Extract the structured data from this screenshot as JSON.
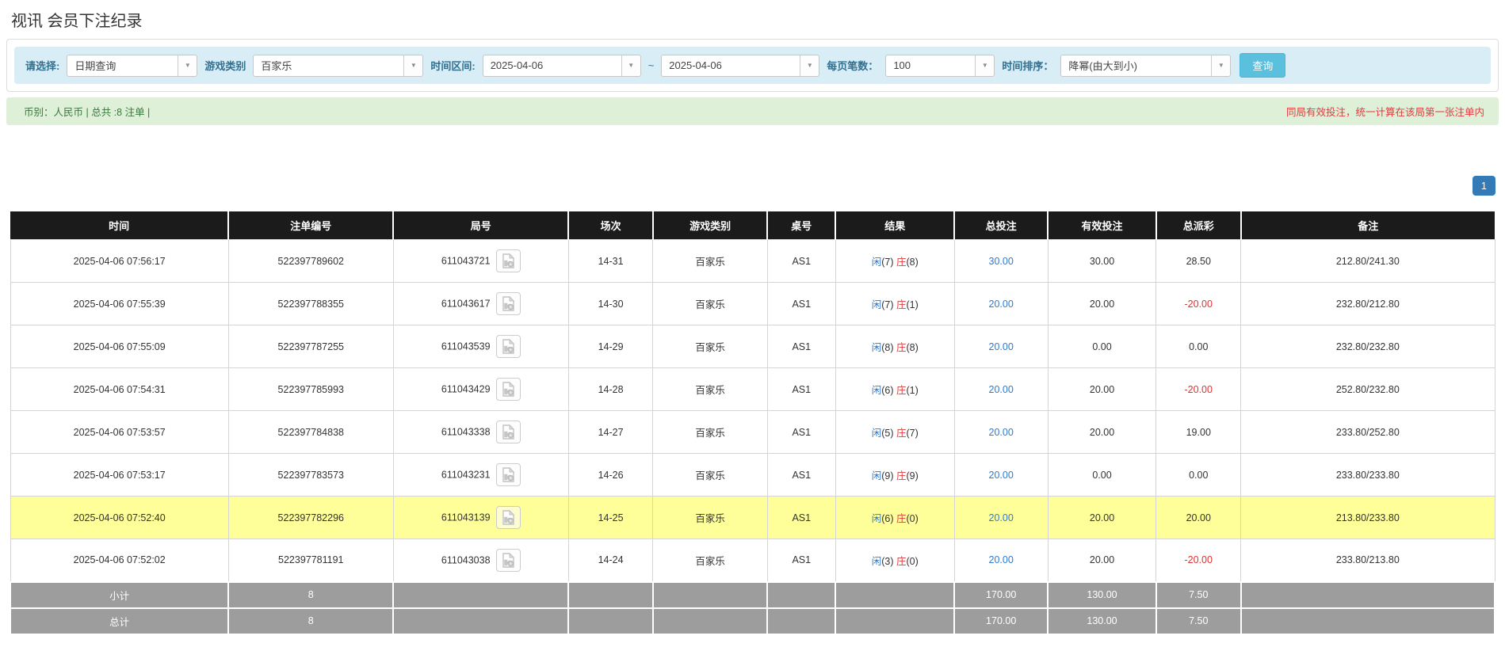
{
  "page_title": "视讯 会员下注纪录",
  "filters": {
    "query_type": {
      "label": "请选择:",
      "value": "日期查询"
    },
    "game_category": {
      "label": "游戏类别",
      "value": "百家乐"
    },
    "time_range": {
      "label": "时间区间:",
      "from": "2025-04-06",
      "separator": "~",
      "to": "2025-04-06"
    },
    "page_size": {
      "label": "每页笔数：",
      "value": "100"
    },
    "time_sort": {
      "label": "时间排序：",
      "value": "降幂(由大到小)"
    },
    "search_label": "查询"
  },
  "summary": {
    "info": "币别：人民币 | 总共 :8 注单 |",
    "notice": "同局有效投注，统一计算在该局第一张注单内"
  },
  "pagination": {
    "page": "1"
  },
  "table": {
    "headers": [
      "时间",
      "注单编号",
      "局号",
      "场次",
      "游戏类别",
      "桌号",
      "结果",
      "总投注",
      "有效投注",
      "总派彩",
      "备注"
    ],
    "rows": [
      {
        "time": "2025-04-06 07:56:17",
        "bet_id": "522397789602",
        "round": "611043721",
        "session": "14-31",
        "game": "百家乐",
        "table_no": "AS1",
        "result": {
          "player": "闲",
          "player_score": "(7)",
          "banker": "庄",
          "banker_score": "(8)"
        },
        "total_bet": "30.00",
        "valid_bet": "30.00",
        "payout": "28.50",
        "remark": "212.80/241.30",
        "highlight": false
      },
      {
        "time": "2025-04-06 07:55:39",
        "bet_id": "522397788355",
        "round": "611043617",
        "session": "14-30",
        "game": "百家乐",
        "table_no": "AS1",
        "result": {
          "player": "闲",
          "player_score": "(7)",
          "banker": "庄",
          "banker_score": "(1)"
        },
        "total_bet": "20.00",
        "valid_bet": "20.00",
        "payout": "-20.00",
        "remark": "232.80/212.80",
        "highlight": false
      },
      {
        "time": "2025-04-06 07:55:09",
        "bet_id": "522397787255",
        "round": "611043539",
        "session": "14-29",
        "game": "百家乐",
        "table_no": "AS1",
        "result": {
          "player": "闲",
          "player_score": "(8)",
          "banker": "庄",
          "banker_score": "(8)"
        },
        "total_bet": "20.00",
        "valid_bet": "0.00",
        "payout": "0.00",
        "remark": "232.80/232.80",
        "highlight": false
      },
      {
        "time": "2025-04-06 07:54:31",
        "bet_id": "522397785993",
        "round": "611043429",
        "session": "14-28",
        "game": "百家乐",
        "table_no": "AS1",
        "result": {
          "player": "闲",
          "player_score": "(6)",
          "banker": "庄",
          "banker_score": "(1)"
        },
        "total_bet": "20.00",
        "valid_bet": "20.00",
        "payout": "-20.00",
        "remark": "252.80/232.80",
        "highlight": false
      },
      {
        "time": "2025-04-06 07:53:57",
        "bet_id": "522397784838",
        "round": "611043338",
        "session": "14-27",
        "game": "百家乐",
        "table_no": "AS1",
        "result": {
          "player": "闲",
          "player_score": "(5)",
          "banker": "庄",
          "banker_score": "(7)"
        },
        "total_bet": "20.00",
        "valid_bet": "20.00",
        "payout": "19.00",
        "remark": "233.80/252.80",
        "highlight": false
      },
      {
        "time": "2025-04-06 07:53:17",
        "bet_id": "522397783573",
        "round": "611043231",
        "session": "14-26",
        "game": "百家乐",
        "table_no": "AS1",
        "result": {
          "player": "闲",
          "player_score": "(9)",
          "banker": "庄",
          "banker_score": "(9)"
        },
        "total_bet": "20.00",
        "valid_bet": "0.00",
        "payout": "0.00",
        "remark": "233.80/233.80",
        "highlight": false
      },
      {
        "time": "2025-04-06 07:52:40",
        "bet_id": "522397782296",
        "round": "611043139",
        "session": "14-25",
        "game": "百家乐",
        "table_no": "AS1",
        "result": {
          "player": "闲",
          "player_score": "(6)",
          "banker": "庄",
          "banker_score": "(0)"
        },
        "total_bet": "20.00",
        "valid_bet": "20.00",
        "payout": "20.00",
        "remark": "213.80/233.80",
        "highlight": true
      },
      {
        "time": "2025-04-06 07:52:02",
        "bet_id": "522397781191",
        "round": "611043038",
        "session": "14-24",
        "game": "百家乐",
        "table_no": "AS1",
        "result": {
          "player": "闲",
          "player_score": "(3)",
          "banker": "庄",
          "banker_score": "(0)"
        },
        "total_bet": "20.00",
        "valid_bet": "20.00",
        "payout": "-20.00",
        "remark": "233.80/213.80",
        "highlight": false
      }
    ],
    "subtotal": {
      "label": "小计",
      "count": "8",
      "total_bet": "170.00",
      "valid_bet": "130.00",
      "payout": "7.50"
    },
    "total": {
      "label": "总计",
      "count": "8",
      "total_bet": "170.00",
      "valid_bet": "130.00",
      "payout": "7.50"
    }
  },
  "colors": {
    "filter_bg": "#d9edf7",
    "filter_text": "#31708f",
    "summary_bg": "#dff0d8",
    "summary_text": "#3c763d",
    "notice_red": "#e4393c",
    "header_bg": "#1b1b1b",
    "highlight": "#ffff99",
    "link_blue": "#2b7bd4",
    "banker_red": "#e03a3a",
    "neg_red": "#e03131",
    "page_blue": "#337ab7",
    "search_btn": "#5bc0de",
    "sum_bg": "#9d9d9d"
  }
}
